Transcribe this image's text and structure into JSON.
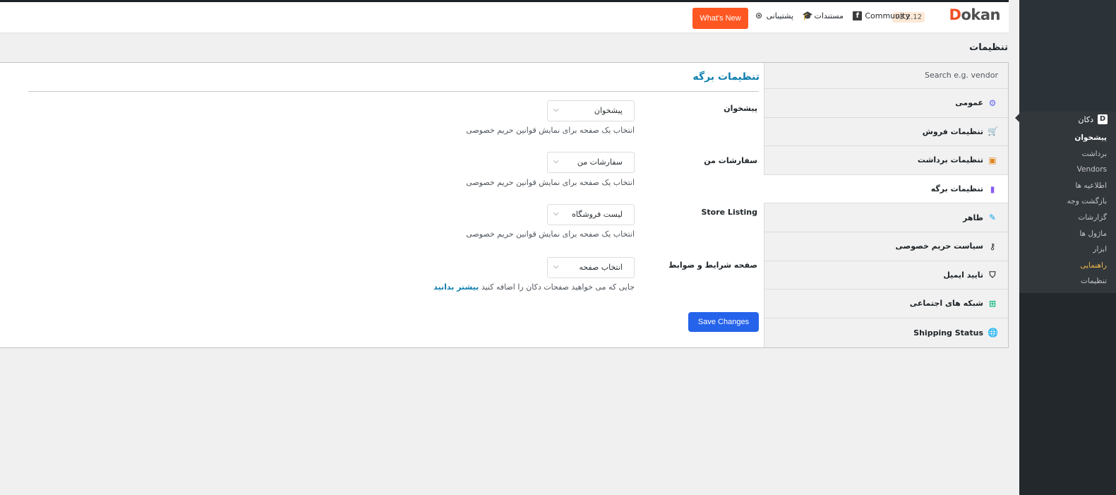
{
  "header": {
    "logo_prefix": "D",
    "logo_rest": "okan",
    "version": "v3.2.12",
    "community_label": "Community",
    "docs_label": "مستندات",
    "support_label": "پشتیبانی",
    "whats_new_label": "What's New"
  },
  "page": {
    "heading": "تنظیمات"
  },
  "settings_nav": {
    "search_placeholder": "Search e.g. vendor",
    "items": [
      {
        "label": "عمومی",
        "icon": "gear-icon",
        "color": "#6366f1"
      },
      {
        "label": "تنظیمات فروش",
        "icon": "cart-icon",
        "color": "#0ea5e9"
      },
      {
        "label": "تنظیمات برداشت",
        "icon": "withdraw-icon",
        "color": "#e0851b"
      },
      {
        "label": "تنظیمات برگه",
        "icon": "page-icon",
        "color": "#8b5cf6"
      },
      {
        "label": "ظاهر",
        "icon": "brush-icon",
        "color": "#0ea5e9"
      },
      {
        "label": "سیاست حریم خصوصی",
        "icon": "key-icon",
        "color": "#1d2327"
      },
      {
        "label": "تایید ایمیل",
        "icon": "shield-icon",
        "color": "#1d2327"
      },
      {
        "label": "شبکه های اجتماعی",
        "icon": "network-icon",
        "color": "#10b981"
      },
      {
        "label": "Shipping Status",
        "icon": "globe-icon",
        "color": "#1d2327"
      }
    ],
    "active_index": 3
  },
  "form": {
    "title": "تنظیمات برگه",
    "fields": [
      {
        "label": "پیشخوان",
        "value": "پیشخوان",
        "description": "انتخاب یک صفحه برای نمایش قوانین حریم خصوصی"
      },
      {
        "label": "سفارشات من",
        "value": "سفارشات من",
        "description": "انتخاب یک صفحه برای نمایش قوانین حریم خصوصی"
      },
      {
        "label": "Store Listing",
        "value": "لیست فروشگاه",
        "description": "انتخاب یک صفحه برای نمایش قوانین حریم خصوصی"
      },
      {
        "label": "صفحه شرایط و ضوابط",
        "value": "انتخاب صفحه",
        "description": "جایی که می خواهید صفحات دکان را اضافه کنید",
        "more_link": "بیشتر بدانید"
      }
    ],
    "save_label": "Save Changes"
  },
  "wp_sidebar": {
    "parent_label": "دکان",
    "submenu": [
      {
        "label": "پیشخوان",
        "state": "current"
      },
      {
        "label": "برداشت",
        "state": "normal"
      },
      {
        "label": "Vendors",
        "state": "normal"
      },
      {
        "label": "اطلاعیه ها",
        "state": "normal"
      },
      {
        "label": "بازگشت وجه",
        "state": "normal"
      },
      {
        "label": "گزارشات",
        "state": "normal"
      },
      {
        "label": "ماژول ها",
        "state": "normal"
      },
      {
        "label": "ابزار",
        "state": "normal"
      },
      {
        "label": "راهنمایی",
        "state": "highlight"
      },
      {
        "label": "تنظیمات",
        "state": "normal"
      }
    ]
  }
}
